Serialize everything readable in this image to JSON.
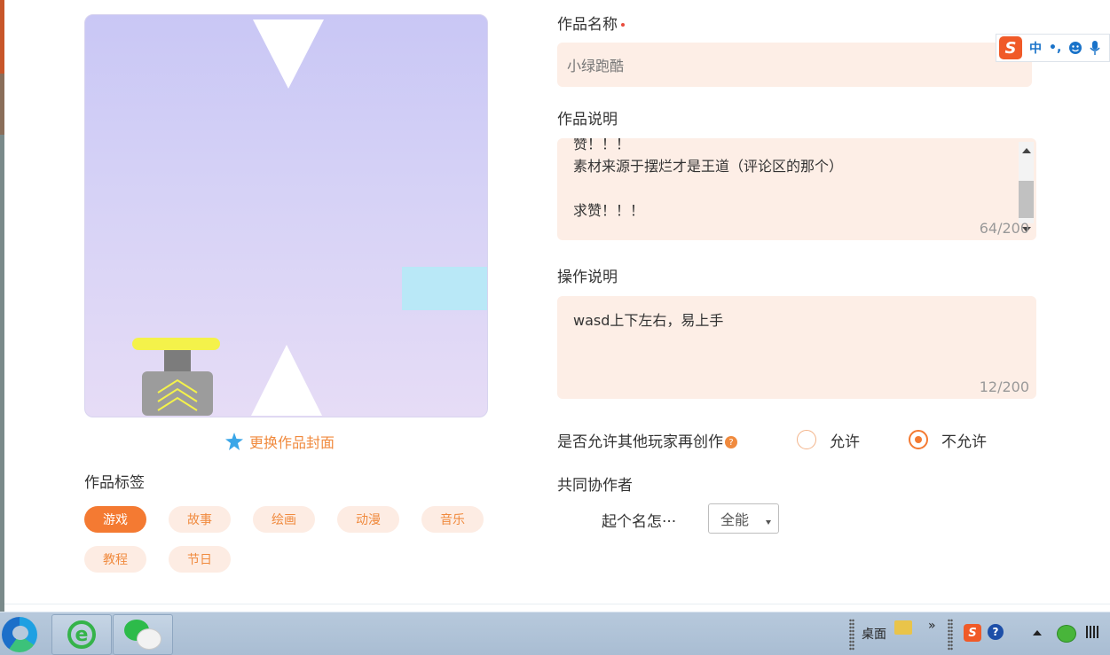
{
  "form": {
    "title_label": "作品名称",
    "title_value": "小绿跑酷",
    "desc_label": "作品说明",
    "desc_lines": [
      "赞！！！",
      "素材来源于摆烂才是王道（评论区的那个）",
      "",
      "求赞！！！"
    ],
    "desc_counter": "64/200",
    "op_label": "操作说明",
    "op_value": "wasd上下左右，易上手",
    "op_counter": "12/200",
    "recreate_label": "是否允许其他玩家再创作",
    "recreate_help": "?",
    "allow_label": "允许",
    "deny_label": "不允许",
    "collab_label": "共同协作者",
    "collab_name": "起个名怎···",
    "collab_role": "全能"
  },
  "cover": {
    "change_label": "更换作品封面"
  },
  "tags": {
    "label": "作品标签",
    "items": [
      "游戏",
      "故事",
      "绘画",
      "动漫",
      "音乐",
      "教程",
      "节日"
    ],
    "active": "游戏"
  },
  "ime": {
    "logo": "S",
    "mode": "中",
    "punct": "•,"
  },
  "taskbar": {
    "desktop_label": "桌面",
    "chevron": "»",
    "ie_glyph": "e",
    "sogou": "S",
    "help": "?"
  },
  "colors": {
    "accent": "#f47a32",
    "field_bg": "#fdeee6"
  }
}
